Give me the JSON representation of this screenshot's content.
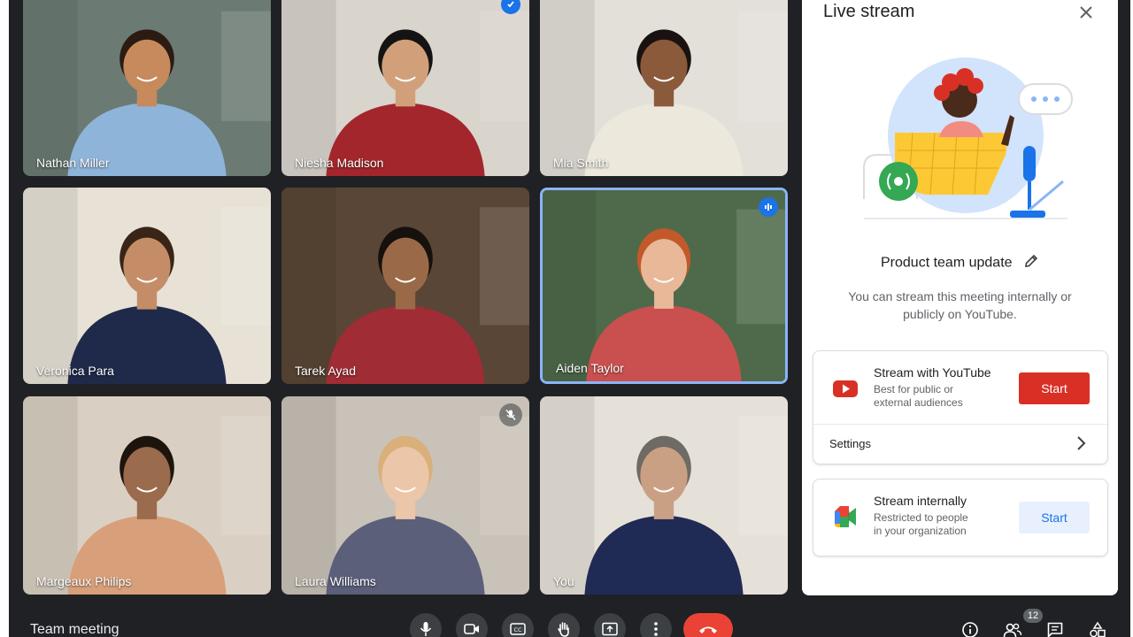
{
  "meeting": {
    "title": "Team meeting"
  },
  "participants": [
    {
      "name": "Nathan Miller",
      "bg": "#6b7b73",
      "shirt": "#8fb4d9",
      "skin": "#c68a5c",
      "hair": "#2b1b12"
    },
    {
      "name": "Niesha Madison",
      "bg": "#d9d4cc",
      "shirt": "#a3262c",
      "skin": "#d1a07a",
      "hair": "#141414"
    },
    {
      "name": "Mia Smith",
      "bg": "#e3e0da",
      "shirt": "#ece8dc",
      "skin": "#8a5a3b",
      "hair": "#1a1210"
    },
    {
      "name": "Veronica Para",
      "bg": "#e8e2d6",
      "shirt": "#1f2a4a",
      "skin": "#c48d68",
      "hair": "#3a2418"
    },
    {
      "name": "Tarek Ayad",
      "bg": "#5a4636",
      "shirt": "#a02c35",
      "skin": "#9a6a48",
      "hair": "#16110d"
    },
    {
      "name": "Aiden Taylor",
      "bg": "#4f6a4a",
      "shirt": "#c9504f",
      "skin": "#e8b899",
      "hair": "#c2592a"
    },
    {
      "name": "Margeaux Philips",
      "bg": "#d9d0c3",
      "shirt": "#d8a07a",
      "skin": "#9a6b4c",
      "hair": "#1e140e"
    },
    {
      "name": "Laura Williams",
      "bg": "#c9c2b8",
      "shirt": "#5b5f7a",
      "skin": "#ecc6a8",
      "hair": "#d9b07a"
    },
    {
      "name": "You",
      "bg": "#e6e1d8",
      "shirt": "#1f2b55",
      "skin": "#caa084",
      "hair": "#6e6a64"
    }
  ],
  "panel": {
    "title": "Live stream",
    "meeting_name": "Product team update",
    "description": "You can stream this meeting internally or publicly on YouTube.",
    "youtube": {
      "title": "Stream with YouTube",
      "subtitle_1": "Best for public or",
      "subtitle_2": "external audiences",
      "button": "Start",
      "settings": "Settings"
    },
    "internal": {
      "title": "Stream internally",
      "subtitle_1": "Restricted to people",
      "subtitle_2": "in your organization",
      "button": "Start"
    }
  },
  "controls": {
    "people_count": "12"
  },
  "colors": {
    "app_bg": "#202124",
    "accent_blue": "#1a73e8",
    "end_call": "#ea4335",
    "youtube_red": "#d93025"
  }
}
